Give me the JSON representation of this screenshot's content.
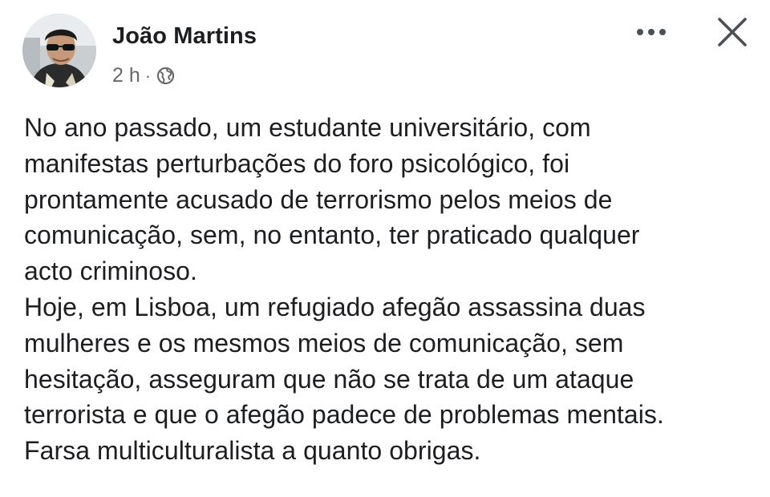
{
  "post": {
    "author": "João Martins",
    "time": "2 h",
    "separator": "·",
    "privacy_icon": "globe-icon",
    "menu_icon": "more-horizontal-icon",
    "close_icon": "close-icon",
    "lines": [
      "No ano passado, um estudante universitário, com",
      "manifestas perturbações do foro psicológico, foi",
      "prontamente acusado de terrorismo pelos meios de",
      "comunicação, sem, no entanto, ter praticado qualquer",
      "acto criminoso.",
      "Hoje, em Lisboa, um refugiado afegão assassina duas",
      "mulheres e os mesmos meios de comunicação, sem",
      "hesitação, asseguram que não se trata de um ataque",
      "terrorista e que o afegão padece de problemas mentais.",
      "Farsa multiculturalista a quanto obrigas."
    ]
  },
  "colors": {
    "text": "#1c1e21",
    "secondary": "#65676b",
    "background": "#ffffff"
  }
}
